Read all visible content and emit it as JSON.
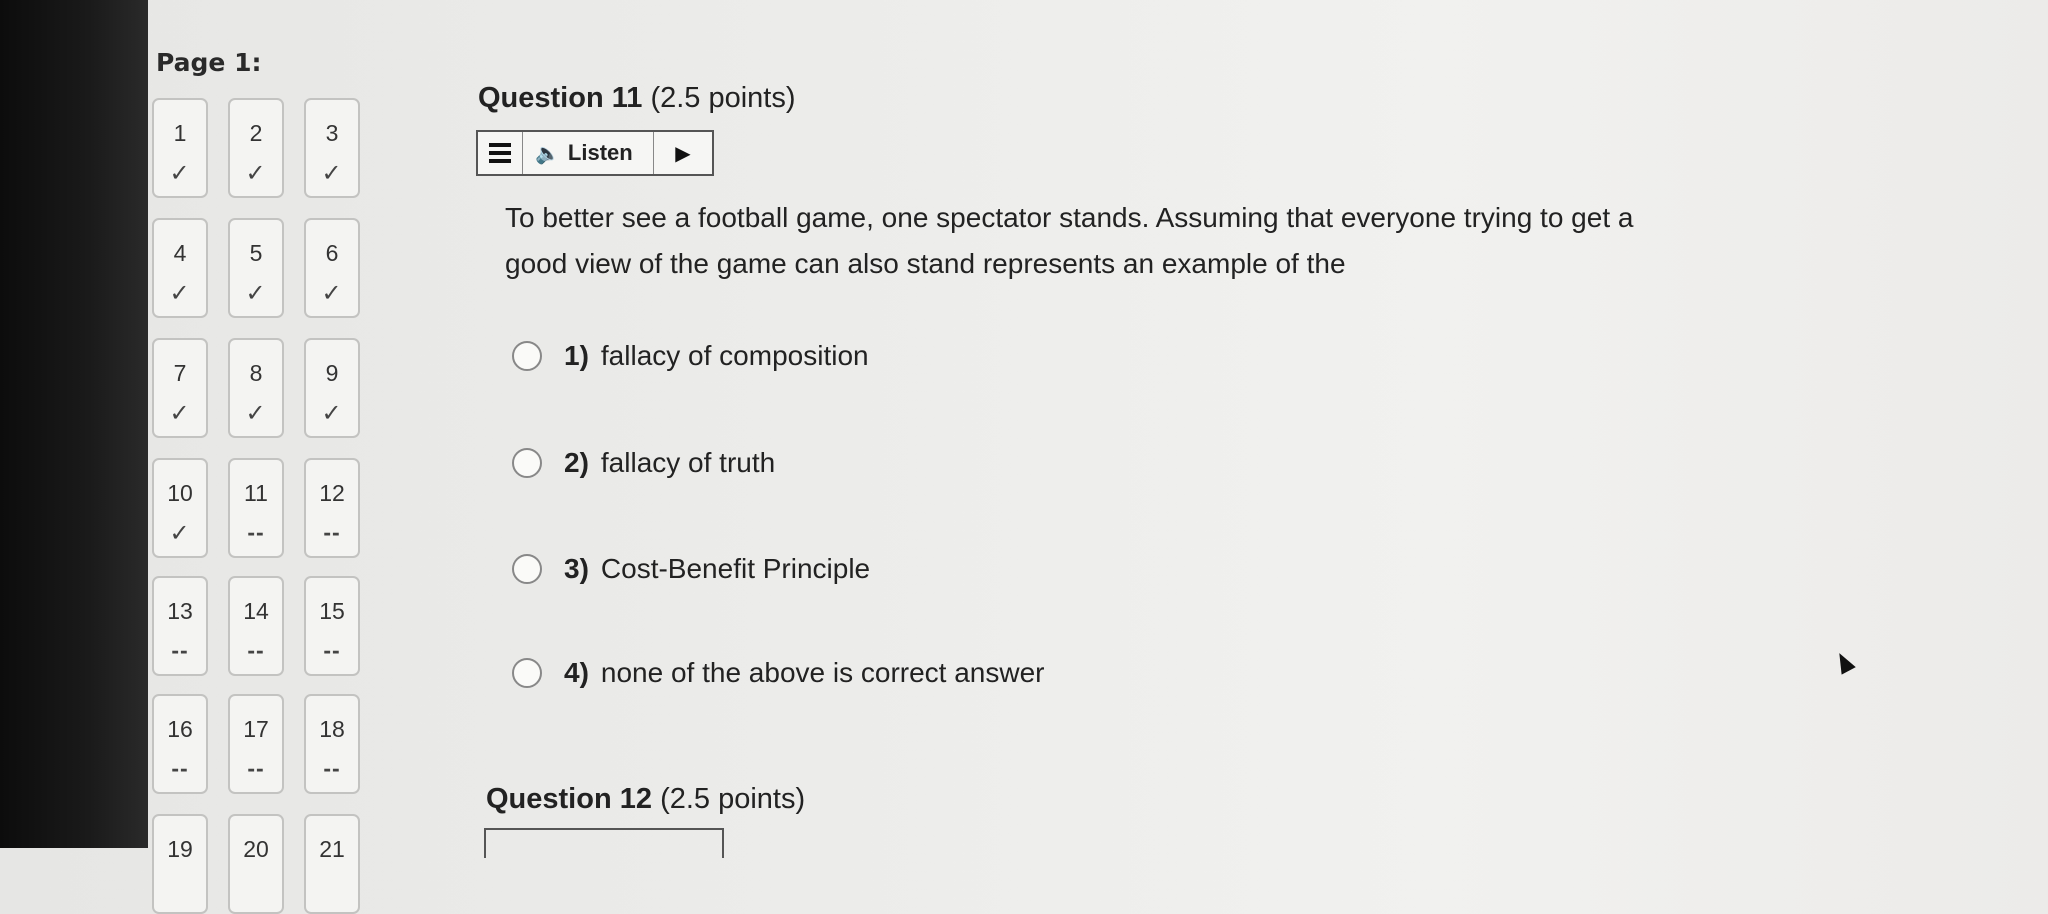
{
  "page": {
    "label": "Page 1:"
  },
  "nav": {
    "questions": [
      {
        "num": "1",
        "mark": "✓"
      },
      {
        "num": "2",
        "mark": "✓"
      },
      {
        "num": "3",
        "mark": "✓"
      },
      {
        "num": "4",
        "mark": "✓"
      },
      {
        "num": "5",
        "mark": "✓"
      },
      {
        "num": "6",
        "mark": "✓"
      },
      {
        "num": "7",
        "mark": "✓"
      },
      {
        "num": "8",
        "mark": "✓"
      },
      {
        "num": "9",
        "mark": "✓"
      },
      {
        "num": "10",
        "mark": "✓"
      },
      {
        "num": "11",
        "mark": "--"
      },
      {
        "num": "12",
        "mark": "--"
      },
      {
        "num": "13",
        "mark": "--"
      },
      {
        "num": "14",
        "mark": "--"
      },
      {
        "num": "15",
        "mark": "--"
      },
      {
        "num": "16",
        "mark": "--"
      },
      {
        "num": "17",
        "mark": "--"
      },
      {
        "num": "18",
        "mark": "--"
      },
      {
        "num": "19",
        "mark": ""
      },
      {
        "num": "20",
        "mark": ""
      },
      {
        "num": "21",
        "mark": ""
      }
    ]
  },
  "question11": {
    "title": "Question 11",
    "points": "(2.5 points)",
    "listen_label": "Listen",
    "text": "To better see a football game, one spectator stands. Assuming that everyone trying to get a good view of the game can also stand represents an example of the",
    "options": [
      {
        "num": "1)",
        "text": "fallacy of composition"
      },
      {
        "num": "2)",
        "text": "fallacy of truth"
      },
      {
        "num": "3)",
        "text": "Cost-Benefit Principle"
      },
      {
        "num": "4)",
        "text": "none of the above is correct answer"
      }
    ]
  },
  "question12": {
    "title": "Question 12",
    "points": "(2.5 points)"
  },
  "icons": {
    "menu": "menu-icon",
    "speaker": "speaker-icon",
    "play": "play-icon",
    "check": "check-icon",
    "cursor": "mouse-cursor-icon"
  }
}
